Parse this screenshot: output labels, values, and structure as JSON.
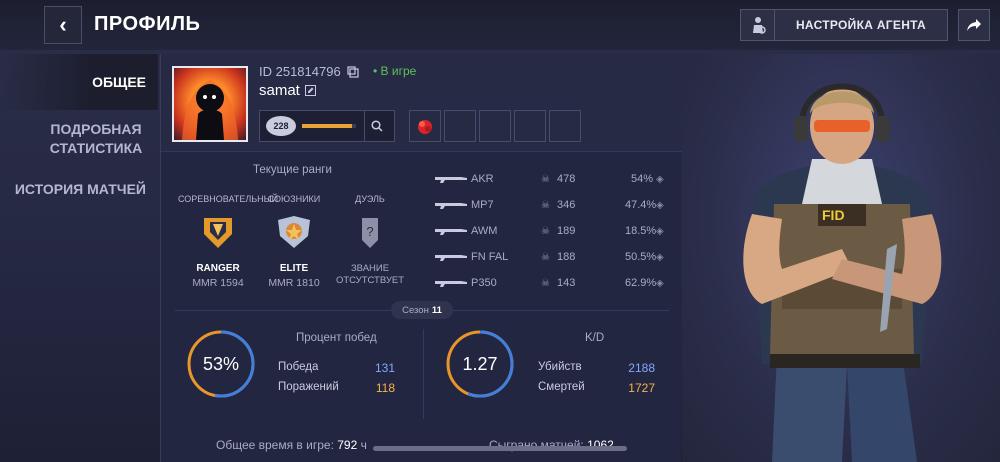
{
  "header": {
    "back_label": "‹",
    "title": "ПРОФИЛЬ",
    "agent_button": "НАСТРОЙКА АГЕНТА"
  },
  "sidebar": {
    "items": [
      {
        "label": "ОБЩЕЕ",
        "active": true
      },
      {
        "label": "ПОДРОБНАЯ СТАТИСТИКА",
        "active": false
      },
      {
        "label": "ИСТОРИЯ МАТЧЕЙ",
        "active": false
      }
    ]
  },
  "player": {
    "id": "ID 251814796",
    "status": "• В игре",
    "nickname": "samat",
    "level": "228",
    "xp_fraction": 0.92
  },
  "ranks": {
    "title": "Текущие ранги",
    "items": [
      {
        "category": "СОРЕВНОВАТЕЛЬНЫЙ",
        "name": "RANGER",
        "mmr": "MMR 1594"
      },
      {
        "category": "СОЮЗНИКИ",
        "name": "ELITE",
        "mmr": "MMR 1810"
      },
      {
        "category": "ДУЭЛЬ",
        "name": "ЗВАНИЕ ОТСУТСТВУЕТ",
        "mmr": ""
      }
    ]
  },
  "weapons": [
    {
      "name": "AKR",
      "kills": "478",
      "pct": "54%"
    },
    {
      "name": "MP7",
      "kills": "346",
      "pct": "47.4%"
    },
    {
      "name": "AWM",
      "kills": "189",
      "pct": "18.5%"
    },
    {
      "name": "FN FAL",
      "kills": "188",
      "pct": "50.5%"
    },
    {
      "name": "P350",
      "kills": "143",
      "pct": "62.9%"
    }
  ],
  "season": {
    "label": "Сезон",
    "number": "11"
  },
  "winrate": {
    "title": "Процент побед",
    "value": "53%",
    "fraction": 0.53,
    "wins_label": "Победа",
    "wins": "131",
    "losses_label": "Поражений",
    "losses": "118"
  },
  "kd": {
    "title": "K/D",
    "value": "1.27",
    "fraction": 0.56,
    "kills_label": "Убийств",
    "kills": "2188",
    "deaths_label": "Смертей",
    "deaths": "1727"
  },
  "footer": {
    "playtime_label": "Общее время в игре:",
    "playtime": "792",
    "playtime_unit": "ч",
    "matches_label": "Сыграно матчей:",
    "matches": "1062"
  }
}
